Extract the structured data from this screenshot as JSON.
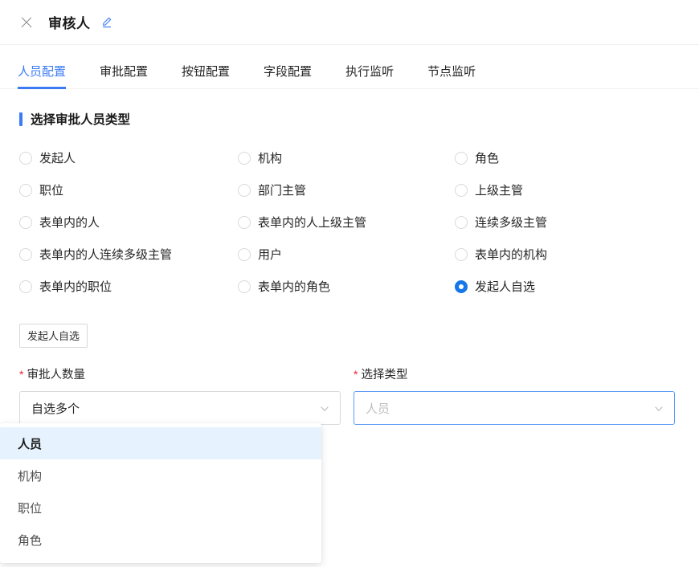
{
  "header": {
    "title": "审核人",
    "close_icon": "close-icon",
    "edit_icon": "edit-pencil-icon"
  },
  "tabs": [
    {
      "label": "人员配置",
      "active": true
    },
    {
      "label": "审批配置",
      "active": false
    },
    {
      "label": "按钮配置",
      "active": false
    },
    {
      "label": "字段配置",
      "active": false
    },
    {
      "label": "执行监听",
      "active": false
    },
    {
      "label": "节点监听",
      "active": false
    }
  ],
  "section": {
    "title": "选择审批人员类型"
  },
  "radio_options": [
    {
      "label": "发起人",
      "checked": false
    },
    {
      "label": "机构",
      "checked": false
    },
    {
      "label": "角色",
      "checked": false
    },
    {
      "label": "职位",
      "checked": false
    },
    {
      "label": "部门主管",
      "checked": false
    },
    {
      "label": "上级主管",
      "checked": false
    },
    {
      "label": "表单内的人",
      "checked": false
    },
    {
      "label": "表单内的人上级主管",
      "checked": false
    },
    {
      "label": "连续多级主管",
      "checked": false
    },
    {
      "label": "表单内的人连续多级主管",
      "checked": false
    },
    {
      "label": "用户",
      "checked": false
    },
    {
      "label": "表单内的机构",
      "checked": false
    },
    {
      "label": "表单内的职位",
      "checked": false
    },
    {
      "label": "表单内的角色",
      "checked": false
    },
    {
      "label": "发起人自选",
      "checked": true
    }
  ],
  "tag": {
    "label": "发起人自选"
  },
  "form": {
    "approver_count": {
      "label": "审批人数量",
      "required_mark": "*",
      "value": "自选多个"
    },
    "select_type": {
      "label": "选择类型",
      "required_mark": "*",
      "placeholder": "人员",
      "value": "",
      "options": [
        {
          "label": "人员",
          "selected": true
        },
        {
          "label": "机构",
          "selected": false
        },
        {
          "label": "职位",
          "selected": false
        },
        {
          "label": "角色",
          "selected": false
        }
      ]
    }
  },
  "colors": {
    "accent": "#3b7cf5",
    "radio_checked": "#1677e8",
    "required": "#f5222d",
    "dropdown_selected_bg": "#e6f2fd",
    "border": "#d9d9d9"
  }
}
